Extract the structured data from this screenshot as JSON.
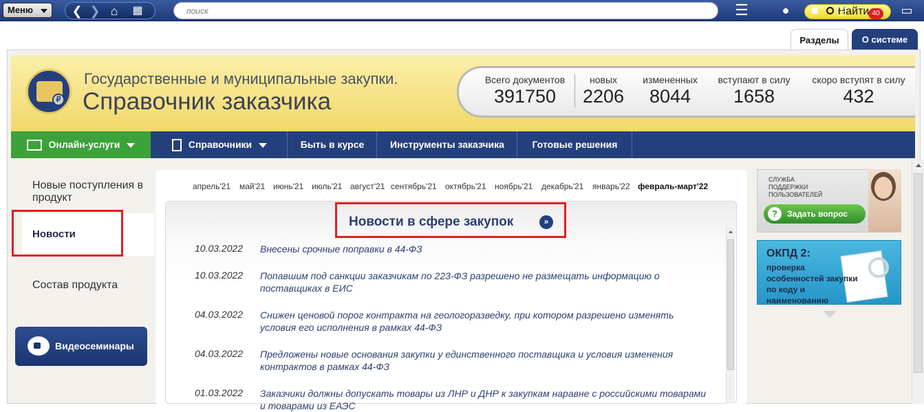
{
  "toolbar": {
    "menu_label": "Меню",
    "search_placeholder": "поиск",
    "find_label": "Найти",
    "notifications_count": "40"
  },
  "tabs": {
    "sections": "Разделы",
    "about": "О системе"
  },
  "banner": {
    "subtitle": "Государственные и муниципальные закупки.",
    "title": "Справочник заказчика",
    "logo_symbol": "₽",
    "stats": [
      {
        "label": "Всего документов",
        "value": "391750"
      },
      {
        "label": "новых",
        "value": "2206"
      },
      {
        "label": "измененных",
        "value": "8044"
      },
      {
        "label": "вступают в силу",
        "value": "1658"
      },
      {
        "label": "скоро вступят в силу",
        "value": "432"
      }
    ]
  },
  "nav": {
    "online": "Онлайн-услуги",
    "references": "Справочники",
    "stay_informed": "Быть в курсе",
    "tools": "Инструменты заказчика",
    "solutions": "Готовые решения"
  },
  "sidebar": {
    "new_items": "Новые поступления в продукт",
    "news": "Новости",
    "contents": "Состав продукта",
    "video": "Видеосеминары"
  },
  "months": [
    {
      "label": "апрель'21",
      "current": false
    },
    {
      "label": "май'21",
      "current": false
    },
    {
      "label": "июнь'21",
      "current": false
    },
    {
      "label": "июль'21",
      "current": false
    },
    {
      "label": "август'21",
      "current": false
    },
    {
      "label": "сентябрь'21",
      "current": false
    },
    {
      "label": "октябрь'21",
      "current": false
    },
    {
      "label": "ноябрь'21",
      "current": false
    },
    {
      "label": "декабрь'21",
      "current": false
    },
    {
      "label": "январь'22",
      "current": false
    },
    {
      "label": "февраль-март'22",
      "current": true
    }
  ],
  "news": {
    "title": "Новости в сфере закупок",
    "more_symbol": "»",
    "items": [
      {
        "date": "10.03.2022",
        "text": "Внесены срочные поправки в 44-ФЗ"
      },
      {
        "date": "10.03.2022",
        "text": "Попавшим под санкции заказчикам по 223-ФЗ разрешено не размещать информацию о поставщиках в ЕИС"
      },
      {
        "date": "04.03.2022",
        "text": "Снижен ценовой порог контракта на геологоразведку, при котором разрешено изменять условия его исполнения в рамках 44-ФЗ"
      },
      {
        "date": "04.03.2022",
        "text": "Предложены новые основания закупки у единственного поставщика и условия изменения контрактов в рамках 44-ФЗ"
      },
      {
        "date": "01.03.2022",
        "text": "Заказчики должны допускать товары из ЛНР и ДНР к закупкам наравне с российскими товарами и товарами из ЕАЭС"
      }
    ]
  },
  "ads": {
    "support_sub": "СЛУЖБА ПОДДЕРЖКИ ПОЛЬЗОВАТЕЛЕЙ",
    "support_btn": "Задать вопрос",
    "okpd_title": "ОКПД 2:",
    "okpd_text": "проверка особенностей закупки по коду и наименованию"
  }
}
